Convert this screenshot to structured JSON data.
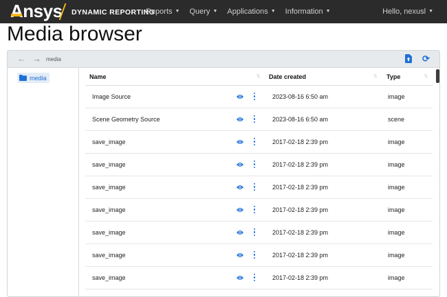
{
  "navbar": {
    "logo": "Ansys",
    "product": "DYNAMIC REPORTING",
    "menus": [
      {
        "label": "Reports"
      },
      {
        "label": "Query"
      },
      {
        "label": "Applications"
      },
      {
        "label": "Information"
      }
    ],
    "user": "Hello, nexusl"
  },
  "page": {
    "title": "Media browser"
  },
  "toolbar": {
    "path": "media",
    "icons": [
      "back-arrow-icon",
      "forward-arrow-icon",
      "upload-file-icon",
      "refresh-icon"
    ]
  },
  "sidebar": {
    "folders": [
      {
        "label": "media",
        "icon": "folder-icon"
      }
    ]
  },
  "table": {
    "columns": [
      {
        "label": "Name"
      },
      {
        "label": "Date created"
      },
      {
        "label": "Type"
      }
    ],
    "rows": [
      {
        "name": "Image Source",
        "date": "2023-08-16 6:50 am",
        "type": "image"
      },
      {
        "name": "Scene Geometry Source",
        "date": "2023-08-16 6:50 am",
        "type": "scene"
      },
      {
        "name": "save_image",
        "date": "2017-02-18 2:39 pm",
        "type": "image"
      },
      {
        "name": "save_image",
        "date": "2017-02-18 2:39 pm",
        "type": "image"
      },
      {
        "name": "save_image",
        "date": "2017-02-18 2:39 pm",
        "type": "image"
      },
      {
        "name": "save_image",
        "date": "2017-02-18 2:39 pm",
        "type": "image"
      },
      {
        "name": "save_image",
        "date": "2017-02-18 2:39 pm",
        "type": "image"
      },
      {
        "name": "save_image",
        "date": "2017-02-18 2:39 pm",
        "type": "image"
      },
      {
        "name": "save_image",
        "date": "2017-02-18 2:39 pm",
        "type": "image"
      }
    ]
  },
  "colors": {
    "navbar_bg": "#2b2b2b",
    "brand_accent": "#ffb71b",
    "link_blue": "#1f6fd6",
    "toolbar_bg": "#e7eaed"
  }
}
